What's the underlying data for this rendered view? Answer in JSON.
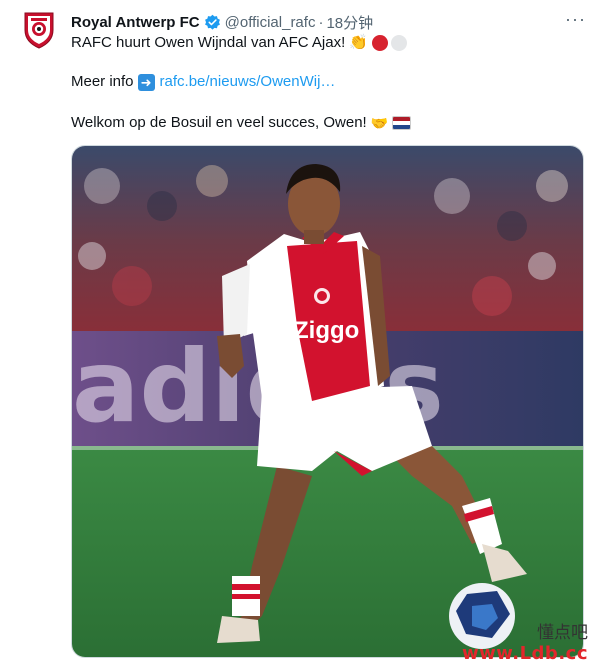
{
  "tweet": {
    "author": {
      "display_name": "Royal Antwerp FC",
      "handle": "@official_rafc",
      "separator": "·",
      "time": "18分钟",
      "verified_icon": "verified-badge-icon",
      "avatar_icon": "rafc-crest-icon"
    },
    "more_label": "···",
    "line1": "RAFC huurt Owen Wijndal van AFC Ajax!",
    "line2_prefix": "Meer info",
    "link_text": "rafc.be/nieuws/OwenWij…",
    "line3": "Welkom op de Bosuil en veel succes, Owen!",
    "emojis": {
      "clap": "👏",
      "arrow": "➜",
      "handshake": "🤝"
    },
    "photo": {
      "shirt_sponsor": "Ziggo",
      "board_text": "adidas"
    }
  },
  "watermark": {
    "cn": "懂点吧",
    "url": "www.Ldb.cc"
  },
  "colors": {
    "link": "#1d9bf0",
    "ajax_red": "#d2122e",
    "pitch_green": "#2f7d3a"
  }
}
